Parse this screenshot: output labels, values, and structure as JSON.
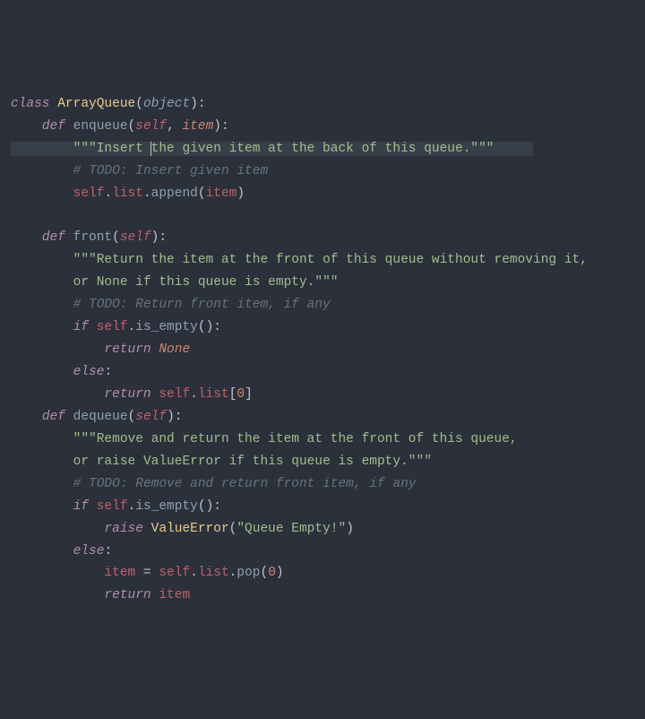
{
  "code": {
    "class_kw": "class",
    "class_name": "ArrayQueue",
    "object": "object",
    "def_kw": "def",
    "enqueue": "enqueue",
    "front": "front",
    "dequeue": "dequeue",
    "self": "self",
    "item": "item",
    "doc_enqueue_a": "\"\"\"Insert ",
    "doc_enqueue_b": "the given item at the back of this queue.\"\"\"",
    "todo_insert": "# TODO: Insert given item",
    "list": "list",
    "append": "append",
    "doc_front_1": "\"\"\"Return the item at the front of this queue without removing it,",
    "doc_front_2": "or None if this queue is empty.\"\"\"",
    "todo_front": "# TODO: Return front item, if any",
    "if_kw": "if",
    "is_empty": "is_empty",
    "return_kw": "return",
    "none": "None",
    "else_kw": "else",
    "zero": "0",
    "doc_dequeue_1": "\"\"\"Remove and return the item at the front of this queue,",
    "doc_dequeue_2": "or raise ValueError if this queue is empty.\"\"\"",
    "todo_dequeue": "# TODO: Remove and return front item, if any",
    "raise_kw": "raise",
    "value_error": "ValueError",
    "queue_empty": "\"Queue Empty!\"",
    "eq": " = ",
    "pop": "pop"
  }
}
